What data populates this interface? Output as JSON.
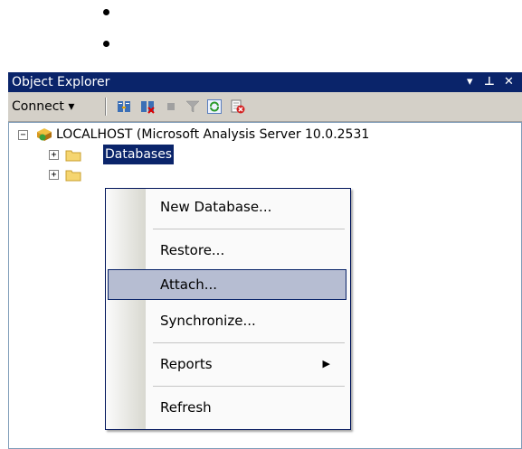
{
  "window": {
    "title": "Object Explorer",
    "controls": {
      "dropdown": "▾",
      "pin": "⊥",
      "close": "✕"
    }
  },
  "toolbar": {
    "connect_label": "Connect ▾",
    "icons": [
      "connect-icon",
      "disconnect-icon",
      "stop-icon",
      "filter-icon",
      "refresh-icon",
      "stop-activity-icon"
    ]
  },
  "tree": {
    "server": "LOCALHOST (Microsoft Analysis Server 10.0.2531",
    "databases": "Databases",
    "expand_symbol": "+",
    "collapse_symbol": "−"
  },
  "context_menu": {
    "items": [
      {
        "label": "New Database..."
      },
      {
        "label": "Restore..."
      },
      {
        "label": "Attach...",
        "highlighted": true
      },
      {
        "label": "Synchronize..."
      },
      {
        "label": "Reports",
        "submenu": "▶"
      },
      {
        "label": "Refresh"
      }
    ]
  },
  "colors": {
    "titlebar": "#0a246a",
    "selection": "#0a246a",
    "menu_hover": "#b6bdd2"
  }
}
